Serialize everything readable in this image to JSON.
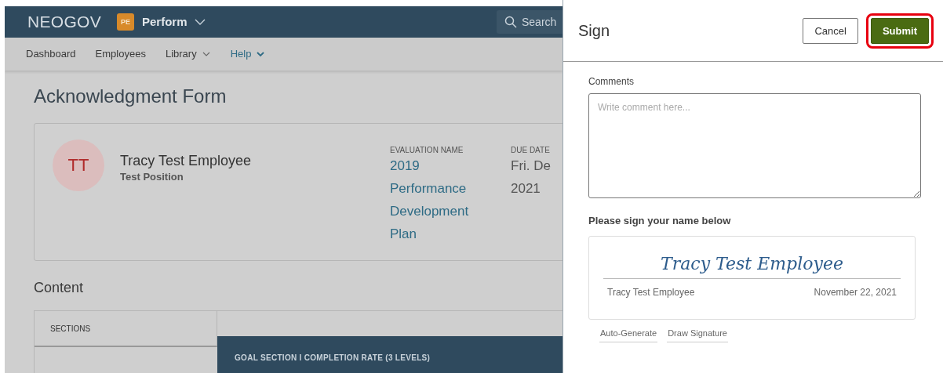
{
  "nav": {
    "brand": "NEOGOV",
    "app_badge": "PE",
    "app_name": "Perform",
    "search": {
      "placeholder": "Search"
    }
  },
  "menu": [
    {
      "label": "Dashboard",
      "selected": false,
      "dropdown": false
    },
    {
      "label": "Employees",
      "selected": false,
      "dropdown": false
    },
    {
      "label": "Library",
      "selected": false,
      "dropdown": true
    },
    {
      "label": "Help",
      "selected": true,
      "dropdown": true
    }
  ],
  "page_title": "Acknowledgment Form",
  "employee": {
    "initials": "TT",
    "name": "Tracy Test Employee",
    "position": "Test Position"
  },
  "evaluation": {
    "label": "EVALUATION NAME",
    "value": "2019 Performance Development Plan"
  },
  "due_date": {
    "label": "DUE DATE",
    "lines": [
      "Fri. De",
      "2021"
    ]
  },
  "content": {
    "title": "Content",
    "sections_header": "SECTIONS",
    "section_banner": "GOAL SECTION I COMPLETION RATE (3 LEVELS)"
  },
  "sign_panel": {
    "title": "Sign",
    "buttons": [
      {
        "label": "Cancel",
        "kind": "secondary",
        "highlighted": false
      },
      {
        "label": "Submit",
        "kind": "primary",
        "highlighted": true
      }
    ],
    "comments": {
      "label": "Comments",
      "placeholder": "Write comment here..."
    },
    "signature": {
      "prompt": "Please sign your name below",
      "signature": "Tracy Test Employee",
      "name": "Tracy Test Employee",
      "date": "November 22, 2021"
    },
    "actions": [
      "Auto-Generate",
      "Draw Signature"
    ]
  }
}
